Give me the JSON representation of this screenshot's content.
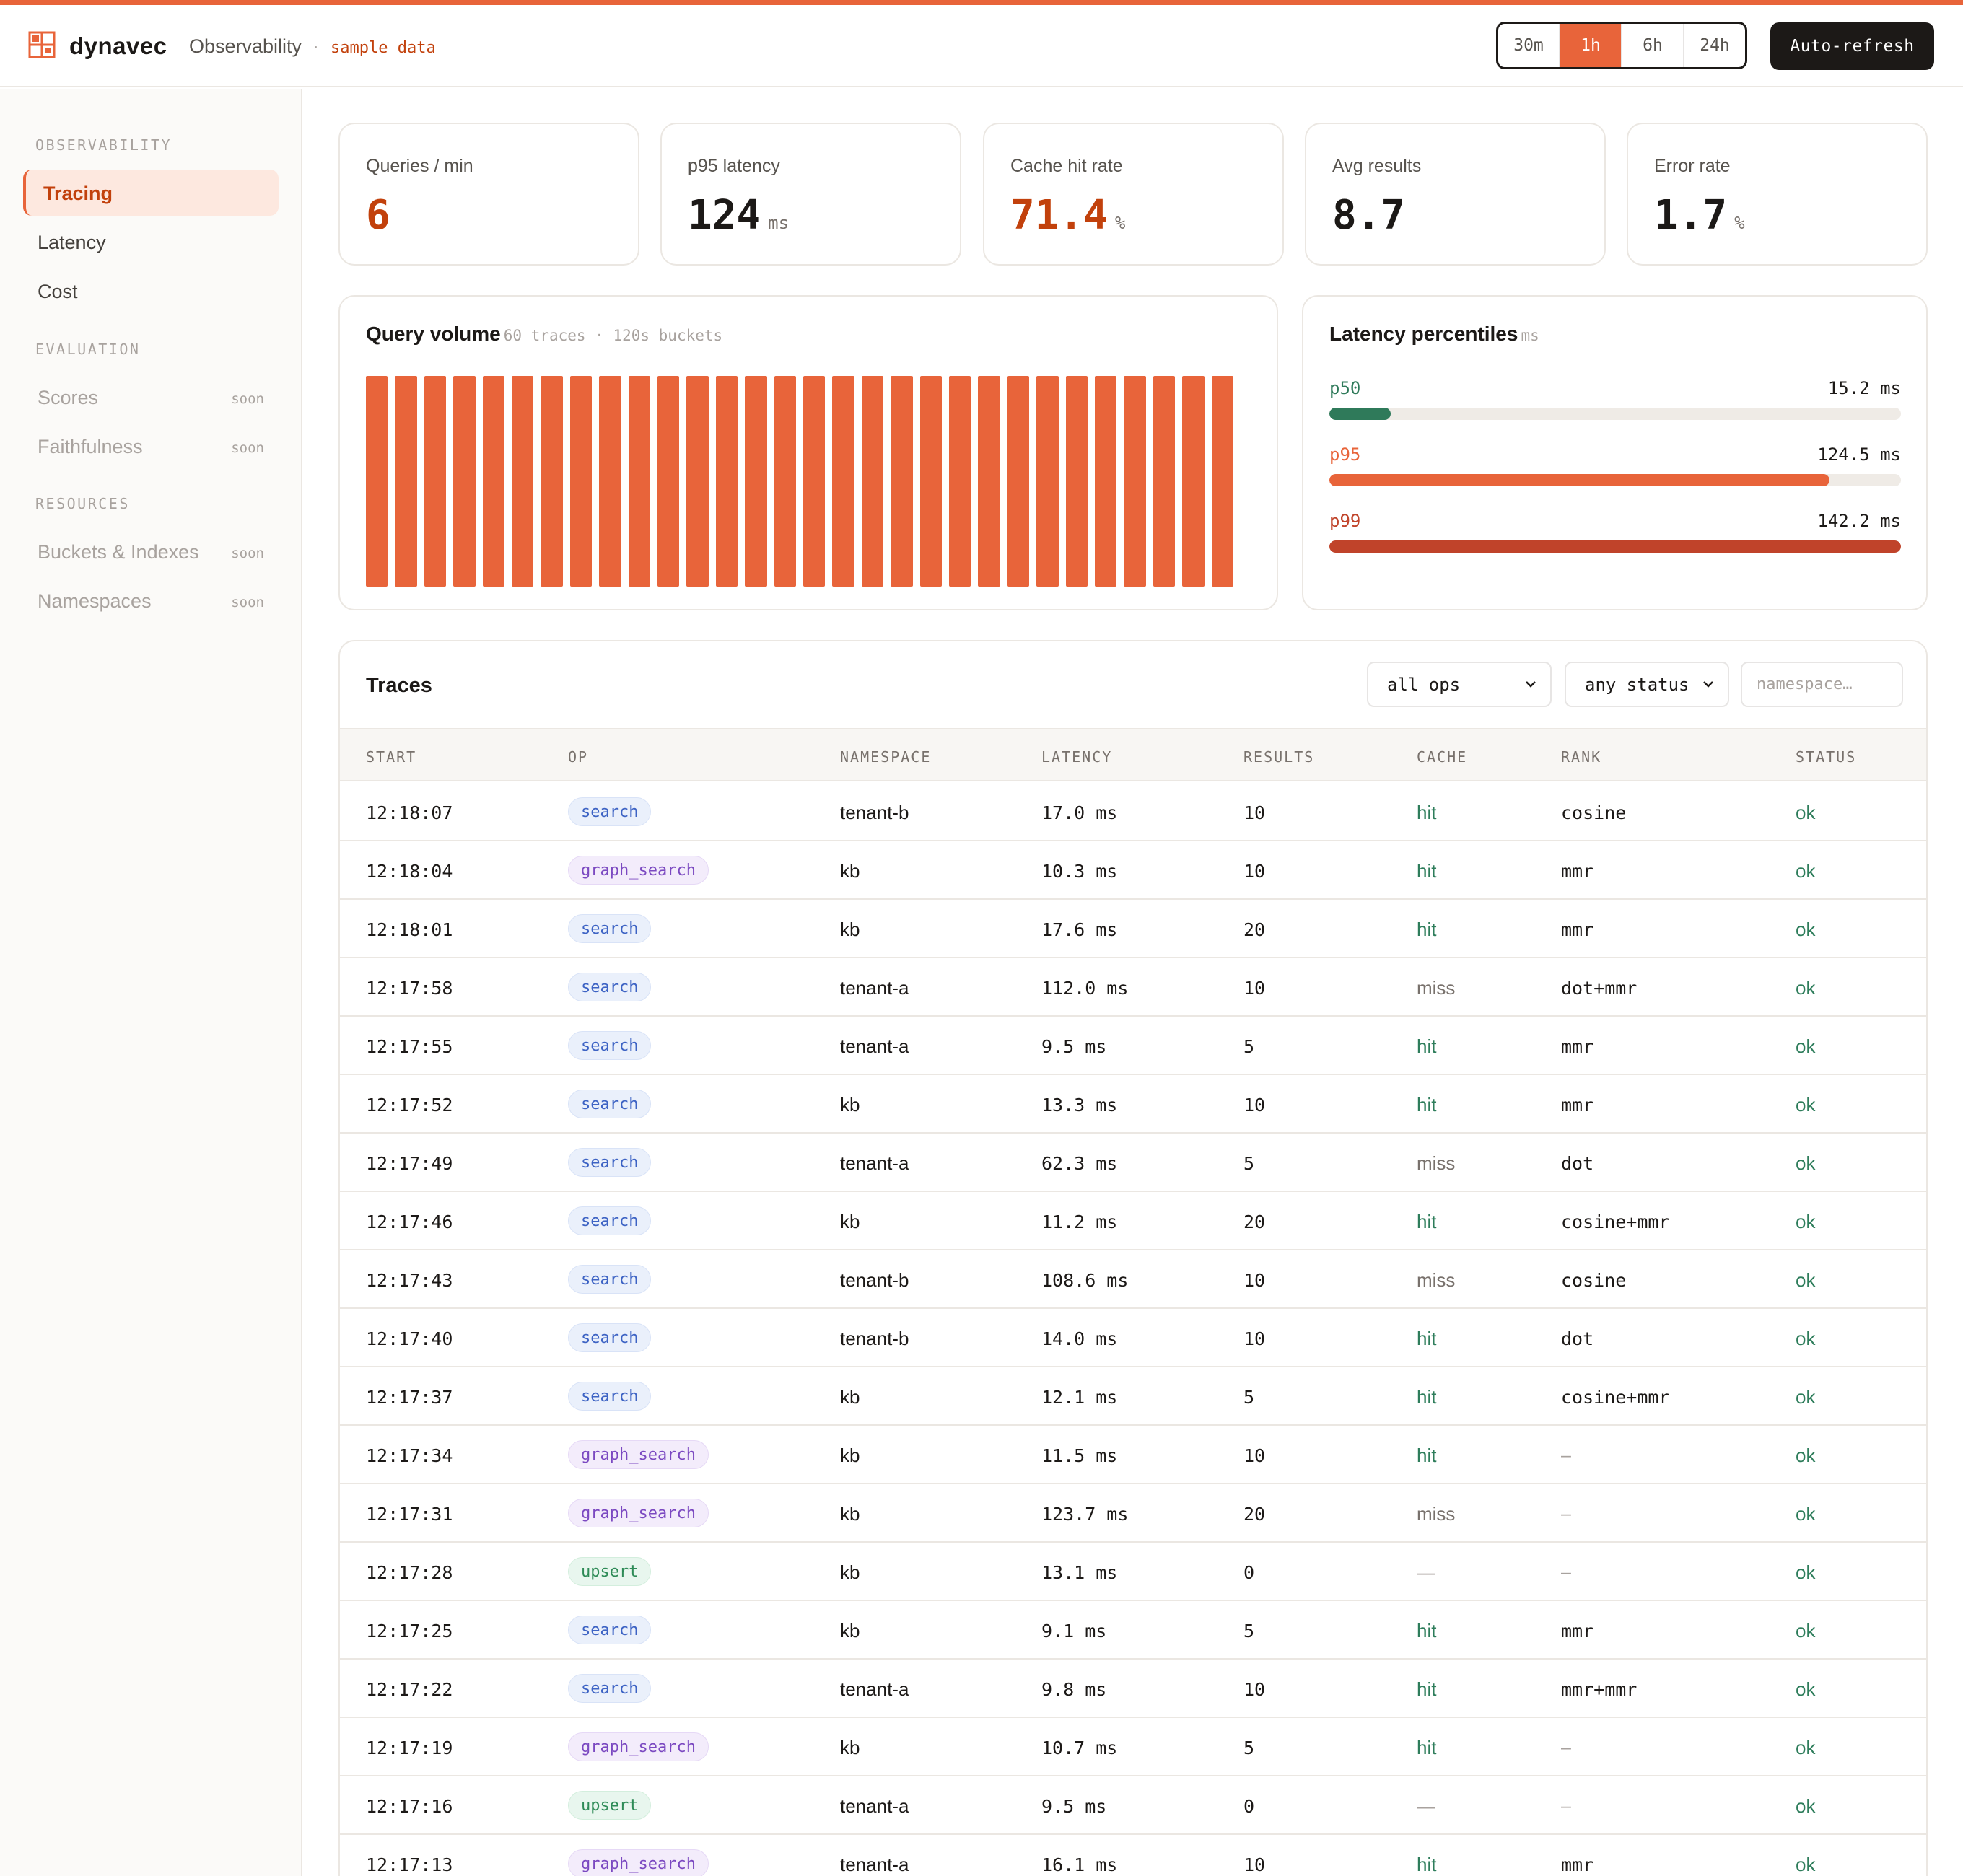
{
  "header": {
    "brand": "dynavec",
    "breadcrumb": "Observability",
    "sample_label": "sample data",
    "ranges": [
      "30m",
      "1h",
      "6h",
      "24h"
    ],
    "active_range": "1h",
    "auto_refresh_label": "Auto-refresh"
  },
  "colors": {
    "accent": "#e8643a",
    "accent_dark": "#c0432a",
    "ok_green": "#2e7d5b",
    "p50_green": "#2f7a5a"
  },
  "sidebar": {
    "sections": [
      {
        "label": "OBSERVABILITY",
        "items": [
          {
            "label": "Tracing",
            "active": true,
            "soon": ""
          },
          {
            "label": "Latency",
            "active": false,
            "soon": ""
          },
          {
            "label": "Cost",
            "active": false,
            "soon": ""
          }
        ]
      },
      {
        "label": "EVALUATION",
        "items": [
          {
            "label": "Scores",
            "active": false,
            "soon": "soon"
          },
          {
            "label": "Faithfulness",
            "active": false,
            "soon": "soon"
          }
        ]
      },
      {
        "label": "RESOURCES",
        "items": [
          {
            "label": "Buckets & Indexes",
            "active": false,
            "soon": "soon"
          },
          {
            "label": "Namespaces",
            "active": false,
            "soon": "soon"
          }
        ]
      }
    ]
  },
  "stats": [
    {
      "label": "Queries / min",
      "value": "6",
      "unit": "",
      "accent": true
    },
    {
      "label": "p95 latency",
      "value": "124",
      "unit": "ms",
      "accent": false
    },
    {
      "label": "Cache hit rate",
      "value": "71.4",
      "unit": "%",
      "accent": true
    },
    {
      "label": "Avg results",
      "value": "8.7",
      "unit": "",
      "accent": false
    },
    {
      "label": "Error rate",
      "value": "1.7",
      "unit": "%",
      "accent": false
    }
  ],
  "query_volume": {
    "title": "Query volume",
    "subtitle": "60 traces · 120s buckets"
  },
  "chart_data": {
    "type": "bar",
    "title": "Query volume",
    "categories": [
      "1",
      "2",
      "3",
      "4",
      "5",
      "6",
      "7",
      "8",
      "9",
      "10",
      "11",
      "12",
      "13",
      "14",
      "15",
      "16",
      "17",
      "18",
      "19",
      "20",
      "21",
      "22",
      "23",
      "24",
      "25",
      "26",
      "27",
      "28",
      "29",
      "30"
    ],
    "values": [
      2,
      2,
      2,
      2,
      2,
      2,
      2,
      2,
      2,
      2,
      2,
      2,
      2,
      2,
      2,
      2,
      2,
      2,
      2,
      2,
      2,
      2,
      2,
      2,
      2,
      2,
      2,
      2,
      2,
      2
    ],
    "ylim": [
      0,
      2
    ],
    "grid": false
  },
  "latency": {
    "title": "Latency percentiles",
    "unit": "ms",
    "max": 142.2,
    "rows": [
      {
        "name": "p50",
        "value": 15.2,
        "value_label": "15.2 ms",
        "color": "#2f7a5a"
      },
      {
        "name": "p95",
        "value": 124.5,
        "value_label": "124.5 ms",
        "color": "#e8643a"
      },
      {
        "name": "p99",
        "value": 142.2,
        "value_label": "142.2 ms",
        "color": "#c0432a"
      }
    ]
  },
  "traces": {
    "title": "Traces",
    "filters": {
      "op": "all ops",
      "status": "any status",
      "namespace_placeholder": "namespace…"
    },
    "columns": [
      "START",
      "OP",
      "NAMESPACE",
      "LATENCY",
      "RESULTS",
      "CACHE",
      "RANK",
      "STATUS"
    ],
    "rows": [
      {
        "start": "12:18:07",
        "op": "search",
        "namespace": "tenant-b",
        "latency": "17.0 ms",
        "results": "10",
        "cache": "hit",
        "rank": "cosine",
        "status": "ok"
      },
      {
        "start": "12:18:04",
        "op": "graph_search",
        "namespace": "kb",
        "latency": "10.3 ms",
        "results": "10",
        "cache": "hit",
        "rank": "mmr",
        "status": "ok"
      },
      {
        "start": "12:18:01",
        "op": "search",
        "namespace": "kb",
        "latency": "17.6 ms",
        "results": "20",
        "cache": "hit",
        "rank": "mmr",
        "status": "ok"
      },
      {
        "start": "12:17:58",
        "op": "search",
        "namespace": "tenant-a",
        "latency": "112.0 ms",
        "results": "10",
        "cache": "miss",
        "rank": "dot+mmr",
        "status": "ok"
      },
      {
        "start": "12:17:55",
        "op": "search",
        "namespace": "tenant-a",
        "latency": "9.5 ms",
        "results": "5",
        "cache": "hit",
        "rank": "mmr",
        "status": "ok"
      },
      {
        "start": "12:17:52",
        "op": "search",
        "namespace": "kb",
        "latency": "13.3 ms",
        "results": "10",
        "cache": "hit",
        "rank": "mmr",
        "status": "ok"
      },
      {
        "start": "12:17:49",
        "op": "search",
        "namespace": "tenant-a",
        "latency": "62.3 ms",
        "results": "5",
        "cache": "miss",
        "rank": "dot",
        "status": "ok"
      },
      {
        "start": "12:17:46",
        "op": "search",
        "namespace": "kb",
        "latency": "11.2 ms",
        "results": "20",
        "cache": "hit",
        "rank": "cosine+mmr",
        "status": "ok"
      },
      {
        "start": "12:17:43",
        "op": "search",
        "namespace": "tenant-b",
        "latency": "108.6 ms",
        "results": "10",
        "cache": "miss",
        "rank": "cosine",
        "status": "ok"
      },
      {
        "start": "12:17:40",
        "op": "search",
        "namespace": "tenant-b",
        "latency": "14.0 ms",
        "results": "10",
        "cache": "hit",
        "rank": "dot",
        "status": "ok"
      },
      {
        "start": "12:17:37",
        "op": "search",
        "namespace": "kb",
        "latency": "12.1 ms",
        "results": "5",
        "cache": "hit",
        "rank": "cosine+mmr",
        "status": "ok"
      },
      {
        "start": "12:17:34",
        "op": "graph_search",
        "namespace": "kb",
        "latency": "11.5 ms",
        "results": "10",
        "cache": "hit",
        "rank": "–",
        "status": "ok"
      },
      {
        "start": "12:17:31",
        "op": "graph_search",
        "namespace": "kb",
        "latency": "123.7 ms",
        "results": "20",
        "cache": "miss",
        "rank": "–",
        "status": "ok"
      },
      {
        "start": "12:17:28",
        "op": "upsert",
        "namespace": "kb",
        "latency": "13.1 ms",
        "results": "0",
        "cache": "—",
        "rank": "–",
        "status": "ok"
      },
      {
        "start": "12:17:25",
        "op": "search",
        "namespace": "kb",
        "latency": "9.1 ms",
        "results": "5",
        "cache": "hit",
        "rank": "mmr",
        "status": "ok"
      },
      {
        "start": "12:17:22",
        "op": "search",
        "namespace": "tenant-a",
        "latency": "9.8 ms",
        "results": "10",
        "cache": "hit",
        "rank": "mmr+mmr",
        "status": "ok"
      },
      {
        "start": "12:17:19",
        "op": "graph_search",
        "namespace": "kb",
        "latency": "10.7 ms",
        "results": "5",
        "cache": "hit",
        "rank": "–",
        "status": "ok"
      },
      {
        "start": "12:17:16",
        "op": "upsert",
        "namespace": "tenant-a",
        "latency": "9.5 ms",
        "results": "0",
        "cache": "—",
        "rank": "–",
        "status": "ok"
      },
      {
        "start": "12:17:13",
        "op": "graph_search",
        "namespace": "tenant-a",
        "latency": "16.1 ms",
        "results": "10",
        "cache": "hit",
        "rank": "mmr",
        "status": "ok"
      }
    ]
  }
}
